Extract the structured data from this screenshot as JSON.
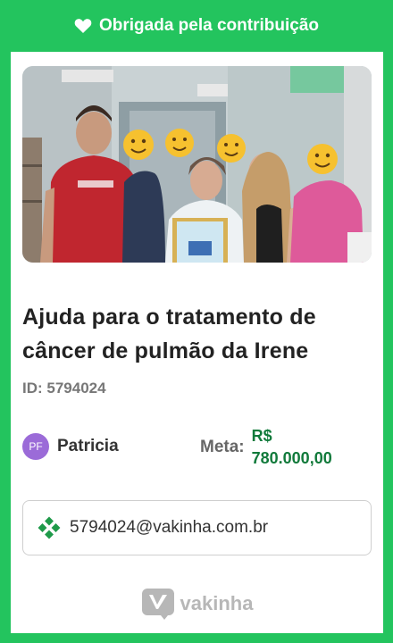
{
  "banner": {
    "text": "Obrigada pela contribuição",
    "icon": "heart-icon"
  },
  "campaign": {
    "photo_alt": "Foto da campanha",
    "title": "Ajuda para o tratamento de câncer de pulmão da Irene",
    "id_label": "ID: 5794024"
  },
  "creator": {
    "initials": "PF",
    "name": "Patricia"
  },
  "goal": {
    "label": "Meta:",
    "currency": "R$",
    "amount": "780.000,00"
  },
  "contact": {
    "icon": "clover-icon",
    "email": "5794024@vakinha.com.br"
  },
  "brand": {
    "name": "vakinha",
    "icon": "vakinha-logo-icon"
  },
  "colors": {
    "background": "#23c45e",
    "goal_value": "#117a3b",
    "avatar": "#9b6bd8"
  }
}
